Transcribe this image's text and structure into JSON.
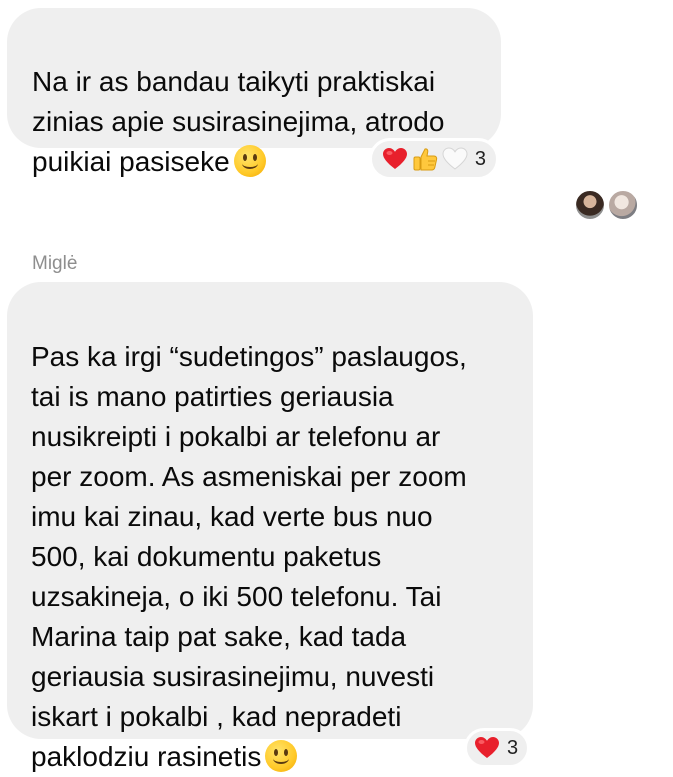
{
  "messages": [
    {
      "text": "Na ir as bandau taikyti praktiskai\nzinias apie susirasinejima, atrodo\npuikiai pasiseke",
      "trailing_emoji": "slightly-smiling-face",
      "reactions": {
        "icons": [
          "red-heart",
          "thumbs-up",
          "white-heart"
        ],
        "count": "3"
      },
      "seen_by_avatars": 2
    },
    {
      "sender": "Miglė",
      "text": "Pas ka irgi “sudetingos” paslaugos,\ntai is mano patirties geriausia\nnusikreipti i pokalbi ar telefonu ar\nper zoom. As asmeniskai per zoom\nimu kai zinau, kad verte bus nuo\n500, kai dokumentu paketus\nuzsakineja, o iki 500 telefonu. Tai\nMarina taip pat sake, kad tada\ngeriausia susirasinejimu, nuvesti\niskart i pokalbi , kad nepradeti\npaklodziu rasinetis",
      "trailing_emoji": "slightly-smiling-face",
      "reactions": {
        "icons": [
          "red-heart"
        ],
        "count": "3"
      }
    }
  ],
  "colors": {
    "bubble": "#efefef",
    "sender_name": "#8e8e8e",
    "heart": "#e8202c"
  }
}
